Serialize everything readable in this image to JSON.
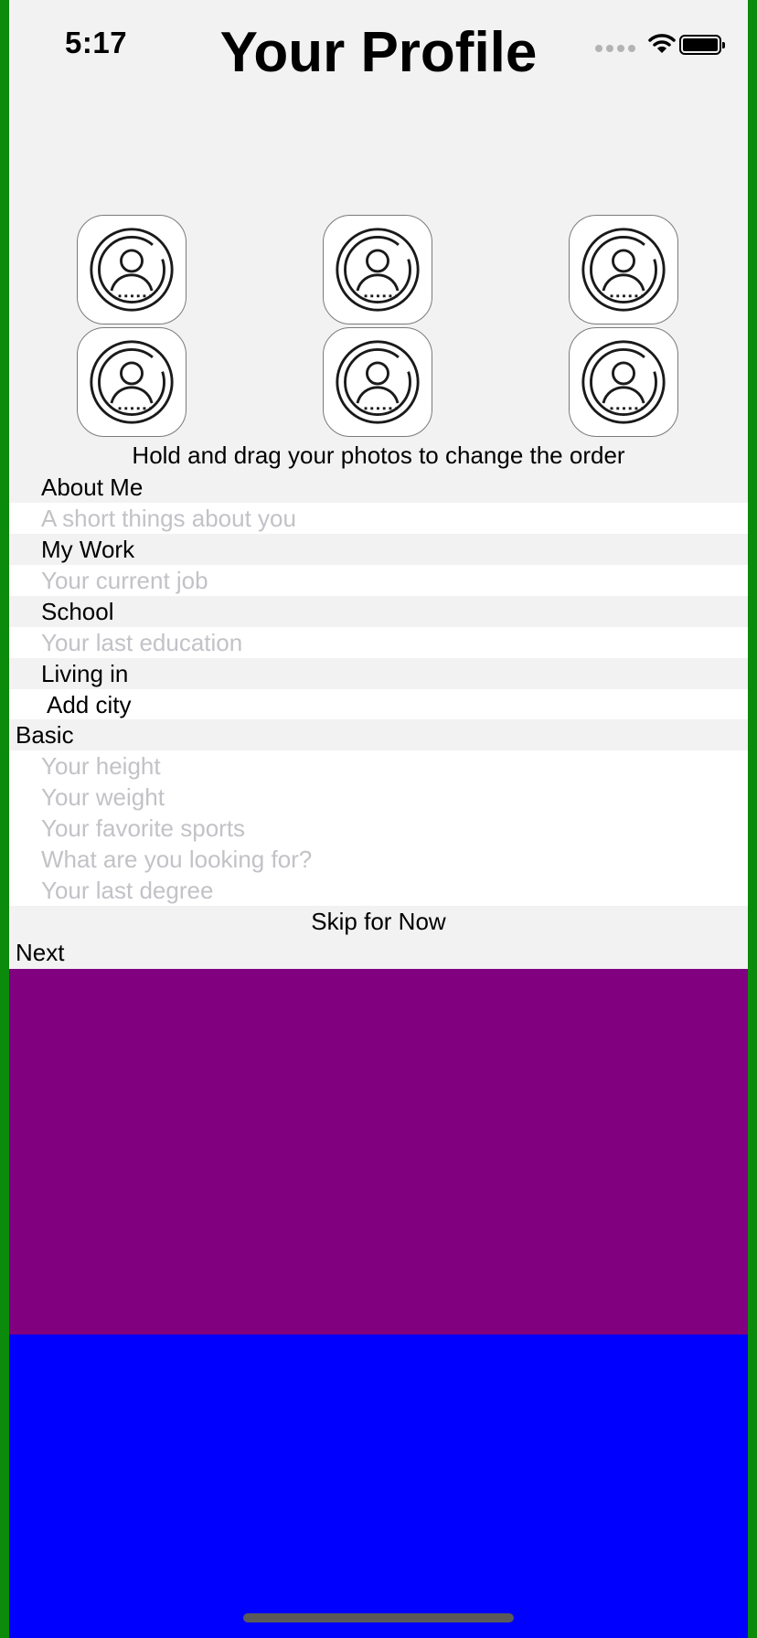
{
  "status_bar": {
    "time": "5:17"
  },
  "header": {
    "title": "Your Profile"
  },
  "photos": {
    "hint": "Hold and drag your photos to change the order"
  },
  "about_me": {
    "label": "About Me",
    "placeholder": "A short things about you"
  },
  "work": {
    "label": "My Work",
    "placeholder": "Your current job"
  },
  "school": {
    "label": "School",
    "placeholder": "Your last education"
  },
  "living": {
    "label": "Living in",
    "add_city": "Add city"
  },
  "basic": {
    "label": "Basic",
    "fields": [
      "Your height",
      "Your weight",
      "Your favorite sports",
      "What are you looking for?",
      "Your last degree"
    ]
  },
  "actions": {
    "skip": "Skip for Now",
    "next": "Next"
  },
  "colors": {
    "frame": "#0b8a0b",
    "background": "#f2f2f2",
    "placeholder": "#c2c2c7",
    "purple_panel": "#800080",
    "blue_panel": "#0000ff"
  }
}
